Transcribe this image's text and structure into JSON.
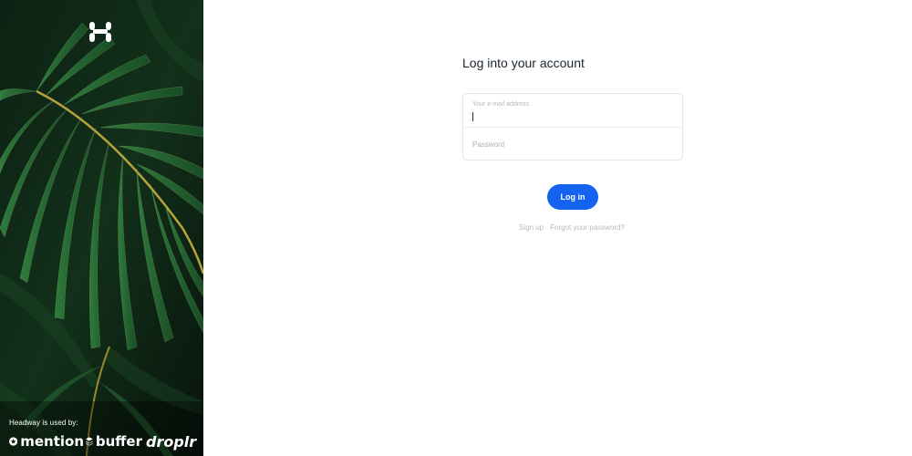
{
  "sidebar": {
    "logo_letter": "H",
    "used_by_label": "Headway is used by:",
    "brands": [
      {
        "name": "mention",
        "icon": "star-badge-icon"
      },
      {
        "name": "buffer",
        "icon": "stack-layers-icon"
      },
      {
        "name": "droplr",
        "icon": ""
      }
    ],
    "background": "tropical-palm-leaf-photo"
  },
  "login": {
    "title": "Log into your account",
    "email_label": "Your e-mail address",
    "email_value": "",
    "password_placeholder": "Password",
    "submit_label": "Log in",
    "signup_link": "Sign up",
    "forgot_link": "Forgot your password?"
  },
  "colors": {
    "primary_button": "#1363f0",
    "muted_text": "#b3b9c0",
    "title_text": "#1b2530",
    "sidebar_bg": "#0b1a10"
  }
}
